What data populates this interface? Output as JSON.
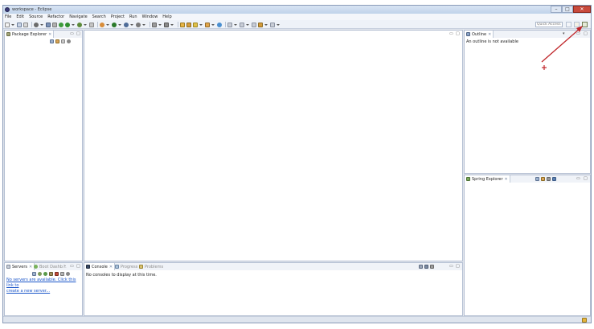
{
  "window": {
    "title": "workspace - Eclipse",
    "controls": {
      "minimize": "–",
      "maximize": "□",
      "close": "✕"
    }
  },
  "menu": {
    "items": [
      "File",
      "Edit",
      "Source",
      "Refactor",
      "Navigate",
      "Search",
      "Project",
      "Run",
      "Window",
      "Help"
    ]
  },
  "toolbar": {
    "quick_access_placeholder": "Quick Access",
    "icons": [
      "new-icon",
      "save-icon",
      "print-icon",
      "gear-icon",
      "debug-icon",
      "run-icon",
      "external-tools-icon",
      "search-icon",
      "open-type-icon",
      "next-annotation-icon",
      "back-icon",
      "forward-icon"
    ],
    "perspective_icons": [
      "open-perspective-icon",
      "java-ee-perspective-icon",
      "spring-perspective-icon"
    ]
  },
  "package_explorer": {
    "tab_label": "Package Explorer",
    "close_glyph": "✕",
    "minimize_glyph": "▭",
    "maximize_glyph": "□"
  },
  "outline": {
    "tab_label": "Outline",
    "close_glyph": "✕",
    "message": "An outline is not available",
    "minimize_glyph": "▭",
    "maximize_glyph": "□"
  },
  "spring_explorer": {
    "tab_label": "Spring Explorer",
    "close_glyph": "✕",
    "minimize_glyph": "▭",
    "maximize_glyph": "□"
  },
  "servers": {
    "tabs": [
      {
        "label": "Servers",
        "active": true
      },
      {
        "label": "Boot Dashb...",
        "active": false
      }
    ],
    "close_glyph": "✕",
    "overflow_glyph": "»",
    "link_text_line1": "No servers are available. Click this link to",
    "link_text_line2": "create a new server...",
    "minimize_glyph": "▭",
    "maximize_glyph": "□"
  },
  "console": {
    "tabs": [
      {
        "label": "Console",
        "active": true
      },
      {
        "label": "Progress",
        "active": false
      },
      {
        "label": "Problems",
        "active": false
      }
    ],
    "close_glyph": "✕",
    "message": "No consoles to display at this time.",
    "minimize_glyph": "▭",
    "maximize_glyph": "□"
  },
  "editor": {
    "minimize_glyph": "▭",
    "maximize_glyph": "□"
  },
  "colors": {
    "annotation_red": "#c0262a",
    "link_blue": "#1a55c9",
    "tab_active_bg": "#ffffff",
    "view_border": "#b5c0d3"
  }
}
